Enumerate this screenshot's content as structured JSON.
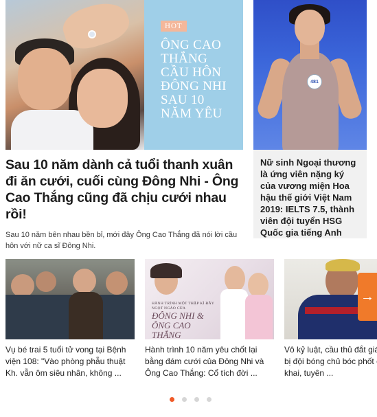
{
  "main_story": {
    "image_badge": "HOT",
    "image_headline": "ÔNG CAO THẮNG CẦU HÔN ĐÔNG NHI SAU 10 NĂM YÊU",
    "title": "Sau 10 năm dành cả tuổi thanh xuân đi ăn cưới, cuối cùng Đông Nhi - Ông Cao Thắng cũng đã chịu cưới nhau rồi!",
    "summary": "Sau 10 năm bên nhau bền bỉ, mới đây Ông Cao Thắng đã nói lời cầu hôn với nữ ca sĩ Đông Nhi."
  },
  "side_story": {
    "badge_number": "481",
    "title": "Nữ sinh Ngoại thương là ứng viên nặng ký của vương miện Hoa hậu thế giới Việt Nam 2019: IELTS 7.5, thành viên đội tuyển HSG Quốc gia tiếng Anh"
  },
  "carousel": {
    "cards": [
      {
        "title": "Vụ bé trai 5 tuổi tử vong tại Bệnh viện 108: \"Vào phòng phẫu thuật Kh. vẫn ôm siêu nhân, không ..."
      },
      {
        "title": "Hành trình 10 năm yêu chốt lại bằng đám cưới của Đông Nhi và Ông Cao Thắng: Cổ tích đời ...",
        "image_caption_small": "HÀNH TRÌNH MỘT THẬP KỈ ĐẦY NGỌT NGÀO CỦA",
        "image_caption_big": "ĐÔNG NHI & ÔNG CAO THẮNG"
      },
      {
        "title": "Vô kỷ luật, cầu thủ đắt giá thế giới bị đội bóng chủ bóc phốt công khai, tuyên ..."
      }
    ],
    "next_icon": "arrow-right-icon",
    "accent_color": "#f07a2a"
  },
  "pagination": {
    "total": 4,
    "active_index": 0,
    "active_color": "#f05a28"
  }
}
